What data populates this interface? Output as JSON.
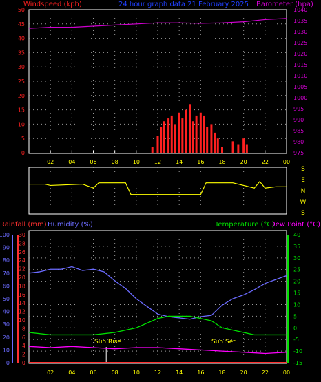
{
  "header": {
    "left_label": "Windspeed (kph)",
    "center_label": "24 hour graph data 21 February 2025",
    "right_label": "Barometer (hpa)"
  },
  "colors": {
    "windspeed": "#ff2020",
    "gust_avg": "#00ff00",
    "barometer": "#d000d0",
    "wind_direction": "#ffff00",
    "rainfall": "#ff3030",
    "humidity": "#6b6bff",
    "temperature": "#00e000",
    "dew_point": "#ff00ff",
    "axis": "#ffffff",
    "time_labels": "#ffff00",
    "grid": "#9a9a9a"
  },
  "lower_header": {
    "rainfall_label": "Rainfall (mm)",
    "humidity_label": "Humidity (%)",
    "temperature_label": "Temperature (°C)",
    "dewpoint_label": "Dew Point (°C)"
  },
  "compass_labels": [
    "S",
    "E",
    "N",
    "W",
    "S"
  ],
  "annotations": {
    "sunrise": "Sun Rise",
    "sunset": "Sun Set"
  },
  "chart_data": [
    {
      "type": "area",
      "xlabel": "",
      "x_ticks": [
        "02",
        "04",
        "06",
        "08",
        "10",
        "12",
        "14",
        "16",
        "18",
        "20",
        "22",
        "00"
      ],
      "ylabel": "Windspeed (kph)",
      "ylim": [
        0,
        50
      ],
      "y_ticks": [
        0,
        5,
        10,
        15,
        20,
        25,
        30,
        35,
        40,
        45,
        50
      ],
      "y2label": "Barometer (hpa)",
      "y2lim": [
        975,
        1040
      ],
      "y2_ticks": [
        975,
        980,
        985,
        990,
        995,
        1000,
        1005,
        1010,
        1015,
        1020,
        1025,
        1030,
        1035,
        1040
      ],
      "series": [
        {
          "name": "Windspeed (kph)",
          "axis": "left",
          "kind": "bars",
          "x": [
            11.5,
            12.0,
            12.3,
            12.6,
            13.0,
            13.3,
            13.6,
            14.0,
            14.3,
            14.6,
            15.0,
            15.3,
            15.6,
            16.0,
            16.3,
            16.6,
            17.0,
            17.3,
            17.6,
            18.0,
            19.0,
            19.5,
            20.0,
            20.3
          ],
          "values": [
            2,
            6,
            9,
            11,
            12,
            13,
            10,
            14,
            12,
            15,
            17,
            11,
            13,
            14,
            13,
            9,
            10,
            7,
            5,
            2,
            4,
            3,
            5,
            3
          ]
        },
        {
          "name": "Barometer (hpa)",
          "axis": "right",
          "kind": "line",
          "x": [
            0,
            2,
            4,
            6,
            8,
            10,
            12,
            14,
            16,
            18,
            20,
            22,
            24
          ],
          "values": [
            1031.5,
            1032,
            1032,
            1032.5,
            1033,
            1033.5,
            1034,
            1034,
            1033.8,
            1034,
            1034.5,
            1035.5,
            1036
          ]
        }
      ]
    },
    {
      "type": "line",
      "ylabel": "",
      "ylim": [
        0,
        360
      ],
      "y_ticks": [
        "S",
        "E",
        "N",
        "W",
        "S"
      ],
      "series": [
        {
          "name": "",
          "x": [
            0,
            1.5,
            2,
            5,
            6,
            6.5,
            9,
            9.5,
            16,
            16.5,
            19,
            20,
            21,
            21.5,
            22,
            23,
            24
          ],
          "values": [
            230,
            230,
            220,
            230,
            200,
            240,
            240,
            150,
            150,
            240,
            240,
            220,
            200,
            250,
            200,
            210,
            210
          ]
        }
      ]
    },
    {
      "type": "line",
      "y_left_outer_label": "Rainfall (mm)",
      "y_left_outer_lim": [
        0,
        30
      ],
      "y_left_outer_ticks": [
        0,
        2,
        4,
        6,
        8,
        10,
        12,
        14,
        16,
        18,
        20,
        22,
        24,
        26,
        28,
        30
      ],
      "y_left_inner_label": "Humidity (%)",
      "y_left_inner_lim": [
        0,
        100
      ],
      "y_left_inner_ticks": [
        0,
        10,
        20,
        30,
        40,
        50,
        60,
        70,
        80,
        90,
        100
      ],
      "y_right_label": "Temperature (°C)",
      "y_right_lim": [
        -15,
        40
      ],
      "y_right_ticks": [
        -15,
        -10,
        -5,
        0,
        5,
        10,
        15,
        20,
        25,
        30,
        35,
        40
      ],
      "series": [
        {
          "name": "Humidity (%)",
          "axis": "humidity",
          "x": [
            0,
            1,
            2,
            3,
            4,
            5,
            6,
            7,
            8,
            9,
            10,
            11,
            12,
            13,
            14,
            15,
            16,
            17,
            18,
            19,
            20,
            21,
            22,
            23,
            24
          ],
          "values": [
            70,
            71,
            73,
            73,
            75,
            72,
            73,
            71,
            64,
            58,
            50,
            44,
            38,
            36,
            35,
            34,
            36,
            37,
            45,
            50,
            53,
            57,
            62,
            65,
            68
          ]
        },
        {
          "name": "Temperature (°C)",
          "axis": "temp",
          "x": [
            0,
            2,
            4,
            6,
            8,
            10,
            11,
            12,
            13,
            14,
            15,
            16,
            17,
            18,
            19,
            20,
            21,
            22,
            23,
            24
          ],
          "values": [
            -2,
            -3,
            -3,
            -3,
            -2,
            0,
            2,
            4,
            5,
            5,
            5,
            4,
            3,
            0,
            -1,
            -2,
            -3,
            -3,
            -3,
            -3
          ]
        },
        {
          "name": "Dew Point (°C)",
          "axis": "temp",
          "x": [
            0,
            2,
            4,
            6,
            8,
            10,
            12,
            14,
            16,
            18,
            20,
            22,
            24
          ],
          "values": [
            -8,
            -8.5,
            -8,
            -8.5,
            -9,
            -8.5,
            -8.5,
            -9,
            -9.5,
            -10,
            -10.5,
            -11,
            -10.5
          ]
        },
        {
          "name": "Rainfall (mm)",
          "axis": "rain",
          "x": [
            0,
            24
          ],
          "values": [
            0,
            0
          ]
        }
      ]
    }
  ]
}
